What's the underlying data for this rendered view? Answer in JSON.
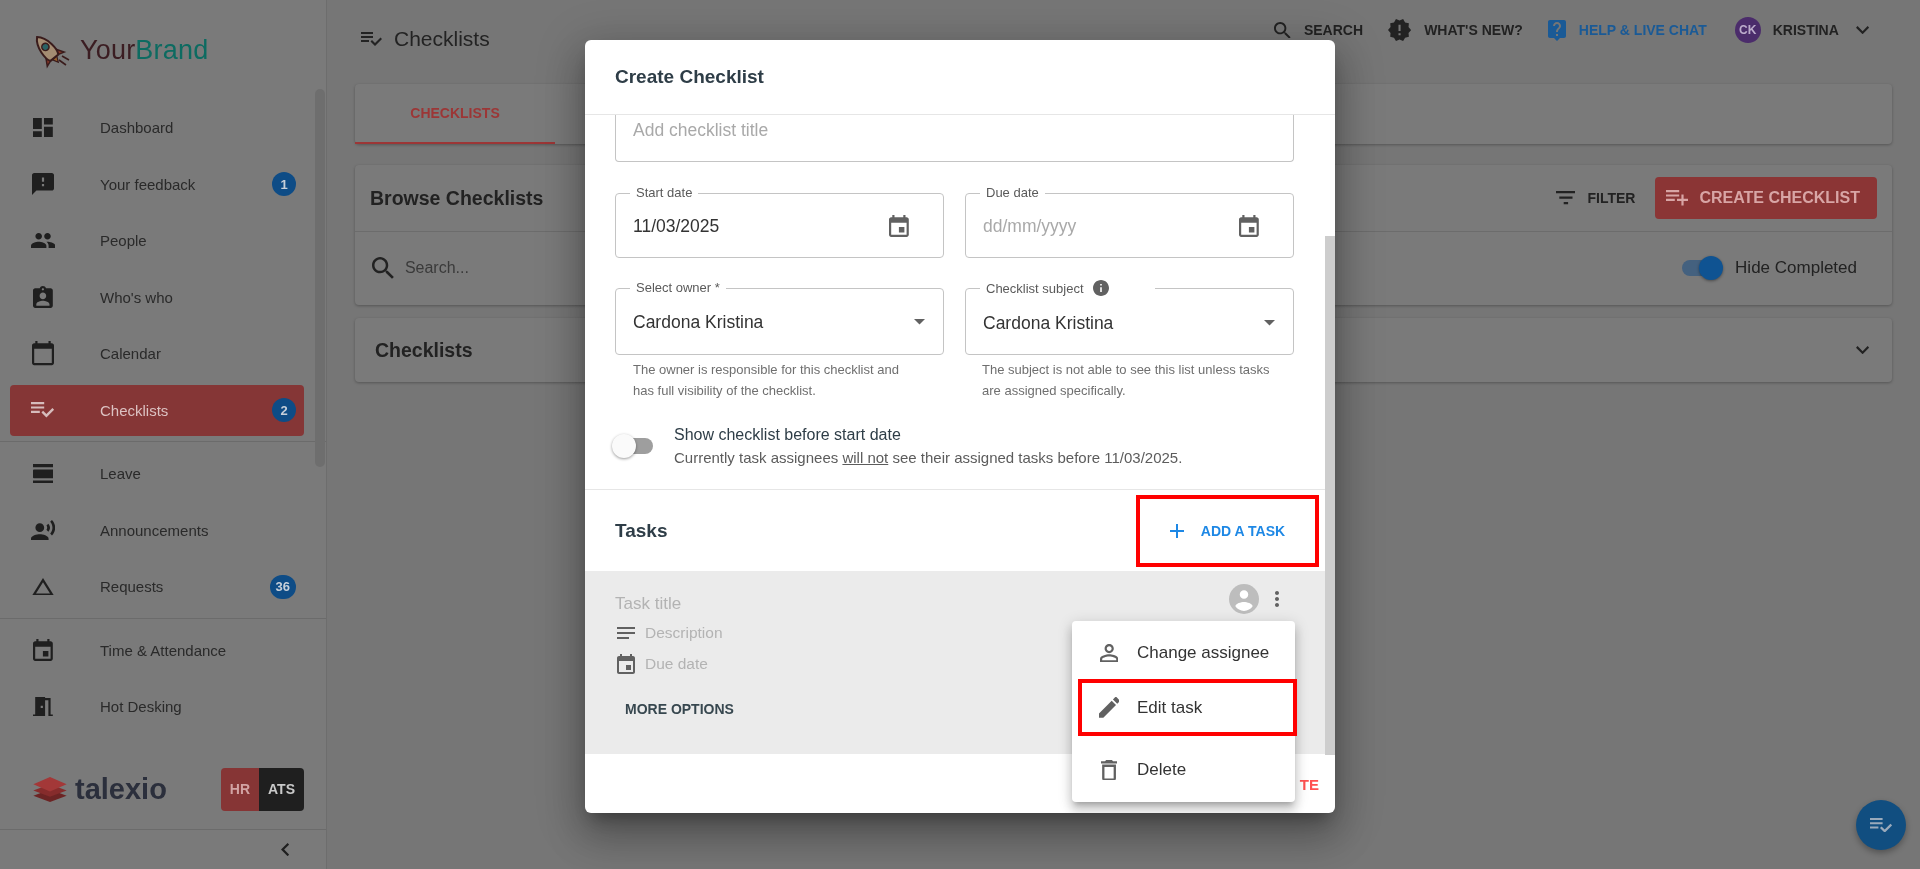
{
  "sidebar": {
    "brand": [
      {
        "text": "Your",
        "color": "#3b1d22"
      },
      {
        "text": "Brand",
        "color": "#0d6b61"
      }
    ],
    "sections": [
      {
        "items": [
          {
            "label": "Dashboard",
            "selected": false
          },
          {
            "label": "Your feedback",
            "badge": "1",
            "selected": false
          },
          {
            "label": "People",
            "selected": false
          },
          {
            "label": "Who's who",
            "selected": false
          },
          {
            "label": "Calendar",
            "selected": false
          },
          {
            "label": "Checklists",
            "badge": "2",
            "selected": true
          }
        ]
      },
      {
        "items": [
          {
            "label": "Leave",
            "selected": false
          },
          {
            "label": "Announcements",
            "selected": false
          },
          {
            "label": "Requests",
            "badge": "36",
            "selected": false
          }
        ]
      },
      {
        "items": [
          {
            "label": "Time & Attendance",
            "selected": false
          },
          {
            "label": "Hot Desking",
            "selected": false
          }
        ]
      }
    ],
    "vendor_logo": "talexio",
    "modules": [
      {
        "label": "HR",
        "selected": true
      },
      {
        "label": "ATS",
        "selected": false
      }
    ]
  },
  "header": {
    "title": "Checklists",
    "actions": [
      {
        "label": "SEARCH",
        "color": "#222222"
      },
      {
        "label": "WHAT'S NEW?",
        "color": "#222222"
      },
      {
        "label": "HELP & LIVE CHAT",
        "color": "#1a5a96"
      }
    ],
    "user": {
      "initials": "CK",
      "name": "KRISTINA"
    }
  },
  "tabs": [
    {
      "label": "CHECKLISTS",
      "selected": true
    }
  ],
  "browse": {
    "title": "Browse Checklists",
    "filter_label": "FILTER",
    "create_label": "CREATE CHECKLIST",
    "search": {
      "placeholder": "Search..."
    },
    "hide_completed": {
      "label": "Hide Completed",
      "on": true
    }
  },
  "checklists_panel": {
    "title": "Checklists",
    "expanded": false
  },
  "dialog": {
    "title": "Create Checklist",
    "title_field": {
      "placeholder": "Add checklist title"
    },
    "date_fields": [
      {
        "label": "Start date",
        "value": "11/03/2025"
      },
      {
        "label": "Due date",
        "placeholder": "dd/mm/yyyy"
      }
    ],
    "select_fields": [
      {
        "label": "Select owner *",
        "value": "Cardona Kristina",
        "helper": "The owner is responsible for this checklist and has full visibility of the checklist."
      },
      {
        "label": "Checklist subject",
        "info": true,
        "value": "Cardona Kristina",
        "helper": "The subject is not able to see this list unless tasks are assigned specifically."
      }
    ],
    "show_before_start": {
      "label": "Show checklist before start date",
      "on": false,
      "note": [
        {
          "text": "Currently task assignees ",
          "underline": false
        },
        {
          "text": "will not",
          "underline": true
        },
        {
          "text": " see their assigned tasks before 11/03/2025.",
          "underline": false
        }
      ]
    },
    "tasks": {
      "title": "Tasks",
      "add_button": {
        "label": "ADD A TASK",
        "highlighted": true
      },
      "items": [
        {
          "title_placeholder": "Task title",
          "description_placeholder": "Description",
          "due_placeholder": "Due date",
          "more_label": "MORE OPTIONS"
        }
      ]
    },
    "task_menu": [
      {
        "label": "Change assignee",
        "highlighted": false
      },
      {
        "label": "Edit task",
        "highlighted": true
      },
      {
        "label": "Delete",
        "highlighted": false
      }
    ],
    "footer_buttons": [
      {
        "label": "TE"
      }
    ]
  }
}
